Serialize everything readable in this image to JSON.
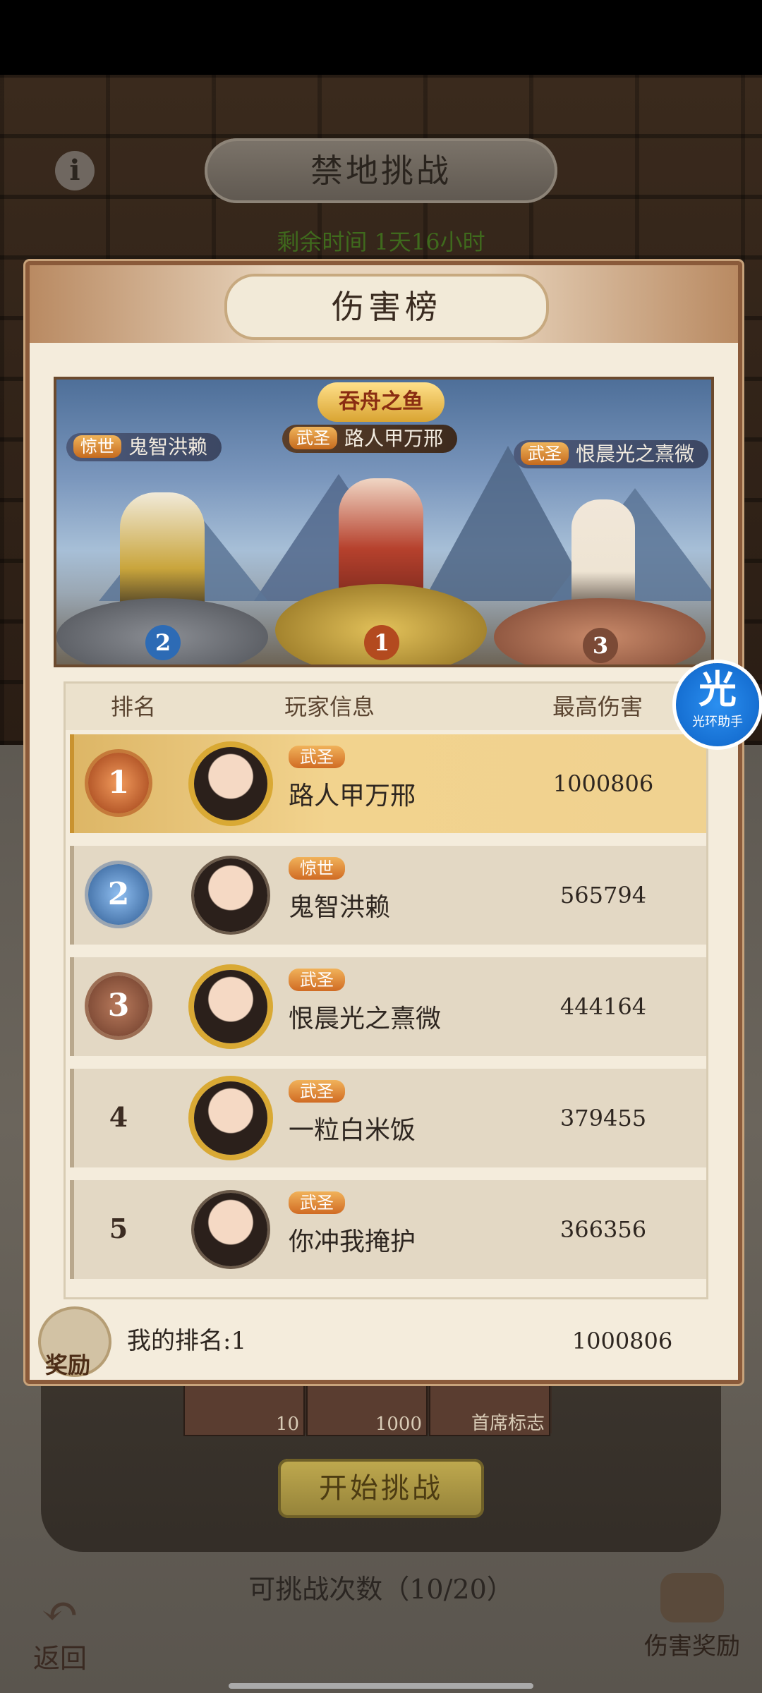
{
  "screen": {
    "title": "禁地挑战",
    "remaining_time": "剩余时间 1天16小时",
    "lower_items": [
      "10",
      "1000",
      "首席标志"
    ],
    "start_button": "开始挑战",
    "attempts": "可挑战次数（10/20）",
    "back_label": "返回",
    "damage_reward_label": "伤害奖励"
  },
  "modal": {
    "title": "伤害榜",
    "banner": {
      "champion_title": "吞舟之鱼",
      "podium": [
        {
          "rank": "1",
          "badge": "武圣",
          "name": "路人甲万邢"
        },
        {
          "rank": "2",
          "badge": "惊世",
          "name": "鬼智洪赖"
        },
        {
          "rank": "3",
          "badge": "武圣",
          "name": "恨晨光之熹微"
        }
      ]
    },
    "table": {
      "headers": {
        "rank": "排名",
        "player": "玩家信息",
        "damage": "最高伤害"
      },
      "rows": [
        {
          "rank": "1",
          "badge": "武圣",
          "name": "路人甲万邢",
          "damage": "1000806"
        },
        {
          "rank": "2",
          "badge": "惊世",
          "name": "鬼智洪赖",
          "damage": "565794"
        },
        {
          "rank": "3",
          "badge": "武圣",
          "name": "恨晨光之熹微",
          "damage": "444164"
        },
        {
          "rank": "4",
          "badge": "武圣",
          "name": "一粒白米饭",
          "damage": "379455"
        },
        {
          "rank": "5",
          "badge": "武圣",
          "name": "你冲我掩护",
          "damage": "366356"
        }
      ]
    },
    "my_rank": {
      "label": "我的排名:1",
      "damage": "1000806",
      "reward_label": "奖励"
    }
  },
  "helper": {
    "big": "光",
    "small": "光环助手"
  },
  "icons": [
    "info-icon",
    "back-arrow-icon",
    "chest-icon",
    "medal-icon",
    "avatar"
  ]
}
